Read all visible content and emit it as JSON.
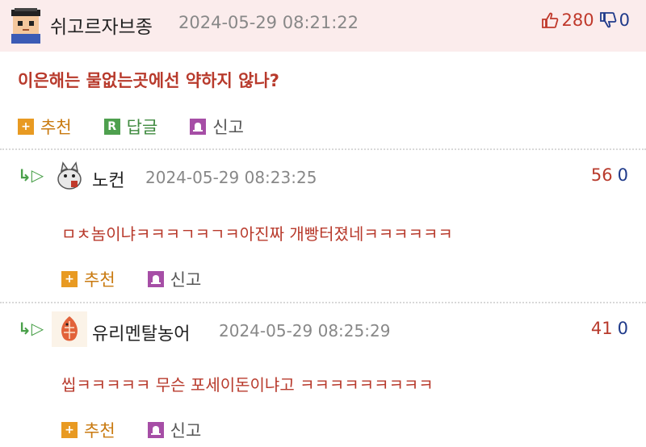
{
  "post": {
    "nickname": "쉬고르자브종",
    "datetime": "2024-05-29 08:21:22",
    "upvotes": "280",
    "downvotes": "0",
    "title": "이은해는 물없는곳에선 약하지 않나?",
    "actions": {
      "recommend": "추천",
      "reply": "답글",
      "report": "신고"
    },
    "reply_badge": "R"
  },
  "comments": [
    {
      "nickname": "노컨",
      "datetime": "2024-05-29 08:23:25",
      "upvotes": "56",
      "downvotes": "0",
      "text": "ㅁㅊ놈이냐ㅋㅋㅋㄱㅋㄱㅋ아진짜 개빵터졌네ㅋㅋㅋㅋㅋㅋ",
      "actions": {
        "recommend": "추천",
        "report": "신고"
      }
    },
    {
      "nickname": "유리멘탈농어",
      "datetime": "2024-05-29 08:25:29",
      "upvotes": "41",
      "downvotes": "0",
      "text": "씹ㅋㅋㅋㅋㅋ 무슨 포세이돈이냐고 ㅋㅋㅋㅋㅋㅋㅋㅋㅋ",
      "actions": {
        "recommend": "추천",
        "report": "신고"
      }
    }
  ],
  "icons": {
    "reply_arrow": "reply-arrow-icon",
    "plus": "plus-icon",
    "reply_badge": "reply-badge-icon",
    "report": "report-icon",
    "thumbs_up": "thumbs-up-icon",
    "thumbs_down": "thumbs-down-icon"
  },
  "colors": {
    "header_bg": "#fbecec",
    "title_red": "#b83a2c",
    "recommend_orange": "#e89a22",
    "reply_green": "#4ea04e",
    "report_purple": "#a64ea6",
    "vote_down_blue": "#1f3a8a"
  }
}
